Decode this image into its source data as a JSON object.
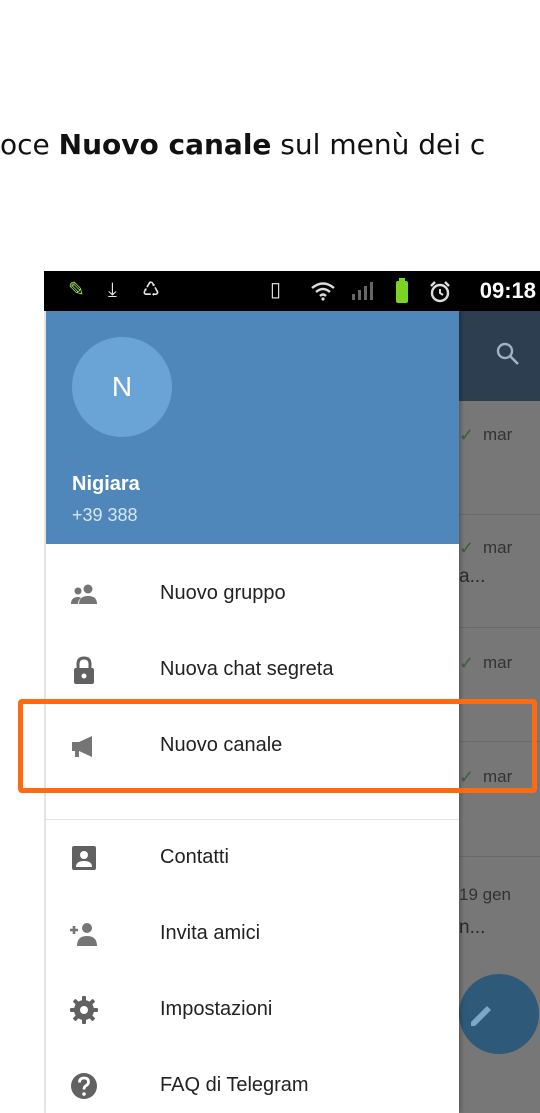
{
  "caption": {
    "prefix": "oce ",
    "bold": "Nuovo canale",
    "suffix": " sul menù dei c"
  },
  "status_bar": {
    "time": "09:18",
    "left_icons": [
      "pencil-icon",
      "download-icon",
      "recycle-icon"
    ],
    "right_icons": [
      "vibrate-icon",
      "wifi-icon",
      "signal-icon",
      "battery-icon",
      "alarm-icon"
    ],
    "battery_color": "#7bd421"
  },
  "drawer": {
    "header_color": "#4f87bb",
    "avatar_letter": "N",
    "user_name": "Nigiara",
    "user_phone": "+39 388",
    "items": [
      {
        "label": "Nuovo gruppo",
        "icon": "group-icon"
      },
      {
        "label": "Nuova chat segreta",
        "icon": "lock-icon"
      },
      {
        "label": "Nuovo canale",
        "icon": "megaphone-icon"
      },
      {
        "label": "Contatti",
        "icon": "contact-card-icon"
      },
      {
        "label": "Invita amici",
        "icon": "add-person-icon"
      },
      {
        "label": "Impostazioni",
        "icon": "gear-icon"
      },
      {
        "label": "FAQ di Telegram",
        "icon": "help-icon"
      }
    ]
  },
  "background_chats": {
    "rows": [
      {
        "check": "✓",
        "date": "mar",
        "snippet": ""
      },
      {
        "check": "✓",
        "date": "mar",
        "snippet": "a..."
      },
      {
        "check": "✓",
        "date": "mar",
        "snippet": ""
      },
      {
        "check": "✓",
        "date": "mar",
        "snippet": ""
      },
      {
        "check": "",
        "date": "19 gen",
        "snippet": "n..."
      }
    ]
  },
  "highlight_color": "#ff6a10"
}
